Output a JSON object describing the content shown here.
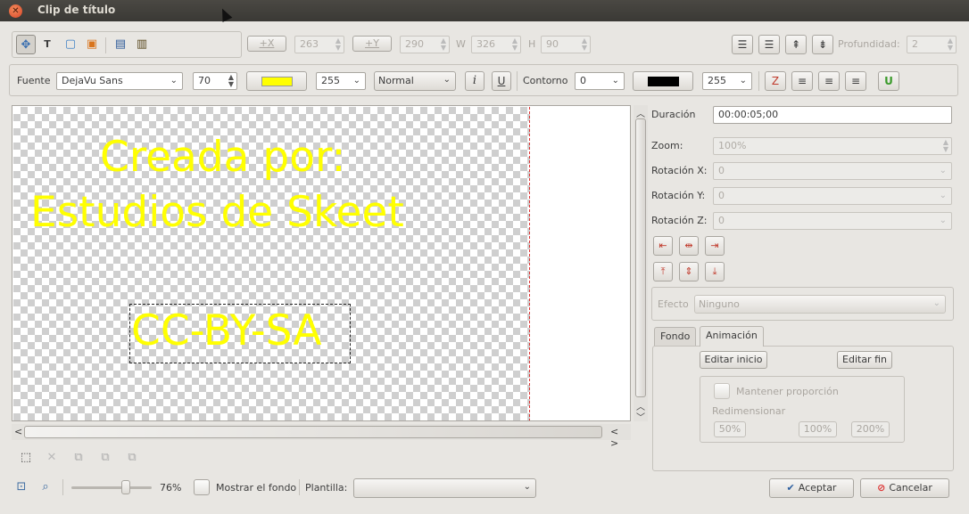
{
  "window": {
    "title": "Clip de título"
  },
  "toolbar1": {
    "x_label": "+X",
    "x_value": "263",
    "y_label": "+Y",
    "y_value": "290",
    "w_label": "W",
    "w_value": "326",
    "h_label": "H",
    "h_value": "90",
    "depth_label": "Profundidad:",
    "depth_value": "2"
  },
  "toolbar2": {
    "font_label": "Fuente",
    "font_value": "DejaVu Sans",
    "size_value": "70",
    "color_hex": "#ffff00",
    "alpha_value": "255",
    "weight_value": "Normal",
    "italic_glyph": "i",
    "underline_glyph": "U",
    "outline_label": "Contorno",
    "outline_value": "0",
    "outline_color_hex": "#000000",
    "outline_alpha_value": "255"
  },
  "canvas": {
    "line1": "Creada por:",
    "line2": "Estudios de Skeet",
    "selected_text": "CC-BY-SA",
    "text_color": "#ffff00"
  },
  "scroll": {
    "left_arrow": "<",
    "right_arrows": "< >"
  },
  "bottom": {
    "zoom_percent": "76%",
    "zoom_fraction": 0.76,
    "show_bg_label": "Mostrar el fondo",
    "template_label": "Plantilla:",
    "template_value": ""
  },
  "right": {
    "duration_label": "Duración",
    "duration_value": "00:00:05;00",
    "zoom_label": "Zoom:",
    "zoom_value": "100%",
    "rotx_label": "Rotación X:",
    "rotx_value": "0",
    "roty_label": "Rotación Y:",
    "roty_value": "0",
    "rotz_label": "Rotación Z:",
    "rotz_value": "0",
    "effect_label": "Efecto",
    "effect_value": "Ninguno",
    "tab_fondo": "Fondo",
    "tab_anim": "Animación",
    "edit_start": "Editar inicio",
    "edit_end": "Editar fin",
    "keep_ratio": "Mantener proporción",
    "resize_label": "Redimensionar",
    "p50": "50%",
    "p100": "100%",
    "p200": "200%"
  },
  "actions": {
    "accept": "Aceptar",
    "cancel": "Cancelar"
  },
  "icons": [
    "close-icon",
    "select-icon",
    "text-icon",
    "rect-icon",
    "image-icon",
    "save-icon",
    "open-icon",
    "align-left-icon",
    "align-hcenter-icon",
    "align-top-icon",
    "align-vcenter-icon",
    "gradient-icon",
    "align-text-left-icon",
    "align-text-center-icon",
    "align-text-right-icon",
    "insert-icon",
    "zoom-fit-icon",
    "zoom-icon"
  ]
}
